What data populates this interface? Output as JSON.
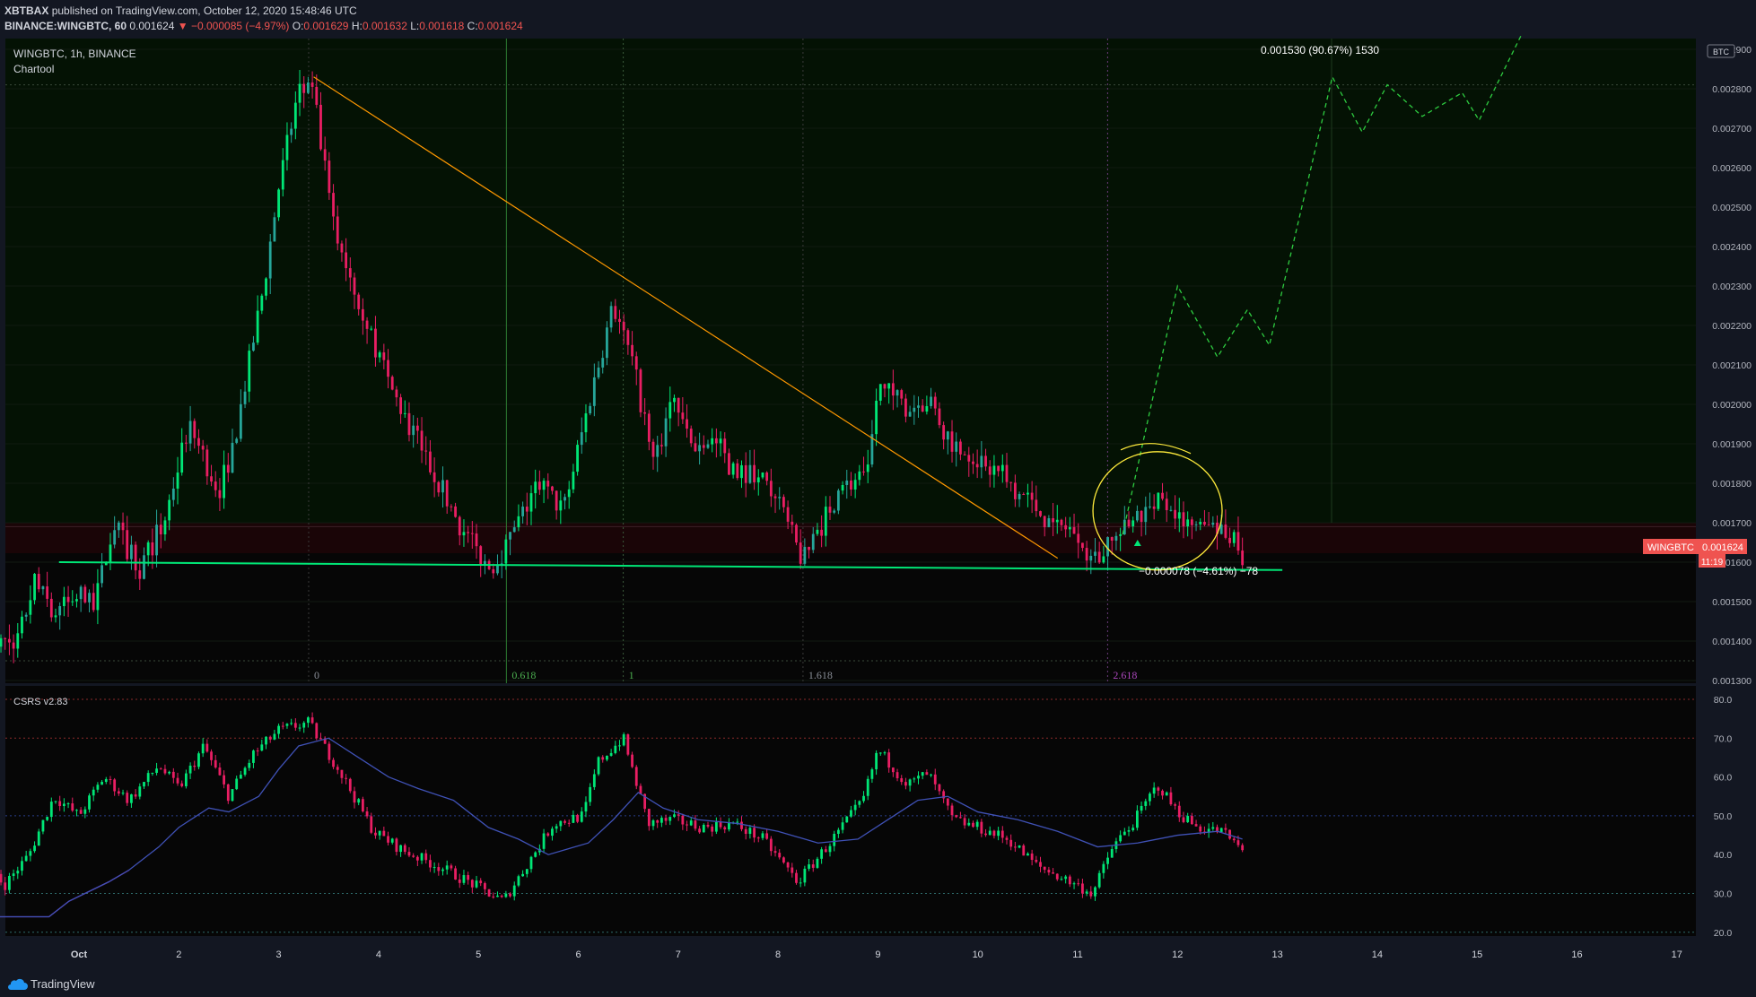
{
  "header": {
    "user": "XBTBAX",
    "published_text": "published on TradingView.com, October 12, 2020 15:48:46 UTC",
    "symbol_line": "BINANCE:WINGBTC, 60",
    "last": "0.001624",
    "change": "▼ −0.000085 (−4.97%)",
    "o_label": "O:",
    "o": "0.001629",
    "h_label": "H:",
    "h": "0.001632",
    "l_label": "L:",
    "l": "0.001618",
    "c_label": "C:",
    "c": "0.001624"
  },
  "pane_title": "WINGBTC, 1h, BINANCE",
  "pane_subtitle": "Chartool",
  "currency_badge": "BTC",
  "price_tag": {
    "symbol": "WINGBTC",
    "value": "0.001624",
    "countdown": "11:19"
  },
  "fib_labels": [
    {
      "text": "0",
      "color": "#8a8f98"
    },
    {
      "text": "0.618",
      "color": "#4caf50"
    },
    {
      "text": "1",
      "color": "#4caf50"
    },
    {
      "text": "1.618",
      "color": "#8a8f98"
    },
    {
      "text": "2.618",
      "color": "#ab47bc"
    }
  ],
  "measure_up": "0.001530 (90.67%) 1530",
  "measure_down": "−0.000078 (−4.61%) −78",
  "indicator_title": "CSRS v2.83",
  "footer": {
    "brand": "TradingView"
  },
  "colors": {
    "up": "#26a69a",
    "up_bright": "#00e676",
    "down": "#e91e63",
    "trend": "#ff9800",
    "support": "#00e676",
    "projection": "#2ecc40",
    "circle": "#ffeb3b",
    "signal": "#3f51b5",
    "signal2": "#9c27b0"
  },
  "chart_data": [
    {
      "type": "candlestick",
      "title": "WINGBTC, 1h, BINANCE",
      "x_ticks": [
        "Oct",
        "2",
        "3",
        "4",
        "5",
        "6",
        "7",
        "8",
        "9",
        "10",
        "11",
        "12",
        "13",
        "14",
        "15",
        "16",
        "17"
      ],
      "y_ticks": [
        "0.001300",
        "0.001400",
        "0.001500",
        "0.001600",
        "0.001700",
        "0.001800",
        "0.001900",
        "0.002000",
        "0.002100",
        "0.002200",
        "0.002300",
        "0.002400",
        "0.002500",
        "0.002600",
        "0.002700",
        "0.002800",
        "0.002900"
      ],
      "ylim": [
        0.00128,
        0.00293
      ],
      "xlim": [
        0.06,
        17.3
      ],
      "path_points": [
        [
          0.05,
          0.0015
        ],
        [
          0.15,
          0.00138
        ],
        [
          0.4,
          0.00141
        ],
        [
          0.55,
          0.00155
        ],
        [
          0.75,
          0.00147
        ],
        [
          1.0,
          0.00152
        ],
        [
          1.15,
          0.00148
        ],
        [
          1.35,
          0.0017
        ],
        [
          1.6,
          0.00158
        ],
        [
          1.85,
          0.0017
        ],
        [
          2.1,
          0.00195
        ],
        [
          2.4,
          0.00178
        ],
        [
          2.55,
          0.0019
        ],
        [
          2.85,
          0.0023
        ],
        [
          3.0,
          0.00255
        ],
        [
          3.2,
          0.0028
        ],
        [
          3.35,
          0.00278
        ],
        [
          3.55,
          0.00245
        ],
        [
          3.9,
          0.0022
        ],
        [
          4.1,
          0.00205
        ],
        [
          4.55,
          0.00183
        ],
        [
          4.8,
          0.0017
        ],
        [
          5.1,
          0.00158
        ],
        [
          5.3,
          0.00165
        ],
        [
          5.6,
          0.0018
        ],
        [
          5.85,
          0.00173
        ],
        [
          6.15,
          0.00205
        ],
        [
          6.35,
          0.00225
        ],
        [
          6.55,
          0.0021
        ],
        [
          6.75,
          0.00185
        ],
        [
          6.95,
          0.00202
        ],
        [
          7.15,
          0.00188
        ],
        [
          7.35,
          0.00192
        ],
        [
          7.55,
          0.00183
        ],
        [
          7.8,
          0.00183
        ],
        [
          8.05,
          0.00172
        ],
        [
          8.25,
          0.0016
        ],
        [
          8.6,
          0.00178
        ],
        [
          8.9,
          0.00182
        ],
        [
          9.0,
          0.00205
        ],
        [
          9.3,
          0.00199
        ],
        [
          9.5,
          0.00201
        ],
        [
          9.75,
          0.0019
        ],
        [
          9.95,
          0.00187
        ],
        [
          10.2,
          0.00183
        ],
        [
          10.5,
          0.00176
        ],
        [
          10.75,
          0.00169
        ],
        [
          11.0,
          0.00168
        ],
        [
          11.15,
          0.0016
        ],
        [
          11.35,
          0.00165
        ],
        [
          11.55,
          0.0017
        ],
        [
          11.8,
          0.00175
        ],
        [
          12.0,
          0.00171
        ],
        [
          12.2,
          0.00168
        ],
        [
          12.45,
          0.00169
        ],
        [
          12.65,
          0.00162
        ]
      ],
      "annotations": {
        "trendline": [
          [
            3.35,
            0.00283
          ],
          [
            10.8,
            0.00161
          ]
        ],
        "support": [
          [
            0.8,
            0.0016
          ],
          [
            13.05,
            0.00158
          ]
        ],
        "resistance_level": 0.00169,
        "dotted_level_top": 0.00281,
        "dotted_level_bottom": 0.00135,
        "projection": [
          [
            11.45,
            0.00167
          ],
          [
            12.0,
            0.0023
          ],
          [
            12.4,
            0.00212
          ],
          [
            12.7,
            0.00224
          ],
          [
            12.92,
            0.00215
          ],
          [
            13.55,
            0.00283
          ],
          [
            13.85,
            0.00269
          ],
          [
            14.1,
            0.00281
          ],
          [
            14.45,
            0.00273
          ],
          [
            14.85,
            0.00279
          ],
          [
            15.02,
            0.00272
          ],
          [
            15.45,
            0.00294
          ]
        ],
        "fib_times": [
          3.3,
          5.28,
          6.45,
          8.25,
          11.3
        ],
        "circle_center": [
          11.8,
          0.00173
        ]
      }
    },
    {
      "type": "bar",
      "title": "CSRS v2.83",
      "y_ticks": [
        "20.0",
        "30.0",
        "40.0",
        "50.0",
        "60.0",
        "70.0",
        "80.0"
      ],
      "ylim": [
        17,
        83
      ],
      "levels": [
        20,
        30,
        50,
        70,
        80
      ],
      "path_points": [
        [
          0.05,
          40
        ],
        [
          0.25,
          32
        ],
        [
          0.5,
          40
        ],
        [
          0.75,
          55
        ],
        [
          1.0,
          50
        ],
        [
          1.25,
          60
        ],
        [
          1.5,
          54
        ],
        [
          1.8,
          63
        ],
        [
          2.0,
          57
        ],
        [
          2.25,
          68
        ],
        [
          2.5,
          55
        ],
        [
          2.75,
          66
        ],
        [
          3.0,
          72
        ],
        [
          3.3,
          74
        ],
        [
          3.6,
          62
        ],
        [
          3.95,
          46
        ],
        [
          4.25,
          41
        ],
        [
          4.6,
          37
        ],
        [
          4.9,
          33
        ],
        [
          5.25,
          28
        ],
        [
          5.45,
          36
        ],
        [
          5.75,
          48
        ],
        [
          6.05,
          50
        ],
        [
          6.2,
          64
        ],
        [
          6.45,
          70
        ],
        [
          6.7,
          48
        ],
        [
          6.95,
          49
        ],
        [
          7.25,
          47
        ],
        [
          7.55,
          48
        ],
        [
          7.85,
          44
        ],
        [
          8.2,
          33
        ],
        [
          8.55,
          44
        ],
        [
          8.85,
          54
        ],
        [
          9.0,
          67
        ],
        [
          9.3,
          58
        ],
        [
          9.5,
          61
        ],
        [
          9.75,
          49
        ],
        [
          10.0,
          47
        ],
        [
          10.3,
          44
        ],
        [
          10.6,
          37
        ],
        [
          10.85,
          34
        ],
        [
          11.15,
          30
        ],
        [
          11.35,
          42
        ],
        [
          11.55,
          48
        ],
        [
          11.8,
          58
        ],
        [
          12.0,
          51
        ],
        [
          12.2,
          47
        ],
        [
          12.45,
          46
        ],
        [
          12.65,
          41
        ]
      ],
      "signal_points": [
        [
          0.05,
          24
        ],
        [
          0.7,
          24
        ],
        [
          0.9,
          28
        ],
        [
          1.3,
          33
        ],
        [
          1.5,
          36
        ],
        [
          1.8,
          42
        ],
        [
          2.0,
          47
        ],
        [
          2.3,
          52
        ],
        [
          2.5,
          51
        ],
        [
          2.8,
          55
        ],
        [
          3.0,
          62
        ],
        [
          3.2,
          68
        ],
        [
          3.5,
          70
        ],
        [
          3.8,
          65
        ],
        [
          4.1,
          60
        ],
        [
          4.4,
          57
        ],
        [
          4.75,
          54
        ],
        [
          5.1,
          47
        ],
        [
          5.4,
          44
        ],
        [
          5.7,
          40
        ],
        [
          6.1,
          43
        ],
        [
          6.35,
          49
        ],
        [
          6.6,
          56
        ],
        [
          6.85,
          52
        ],
        [
          7.2,
          49
        ],
        [
          7.6,
          48
        ],
        [
          8.0,
          46
        ],
        [
          8.4,
          43
        ],
        [
          8.8,
          44
        ],
        [
          9.1,
          49
        ],
        [
          9.4,
          54
        ],
        [
          9.7,
          55
        ],
        [
          10.0,
          51
        ],
        [
          10.4,
          49
        ],
        [
          10.8,
          46
        ],
        [
          11.2,
          42
        ],
        [
          11.6,
          43
        ],
        [
          12.0,
          45
        ],
        [
          12.4,
          46
        ],
        [
          12.65,
          44
        ]
      ]
    }
  ]
}
